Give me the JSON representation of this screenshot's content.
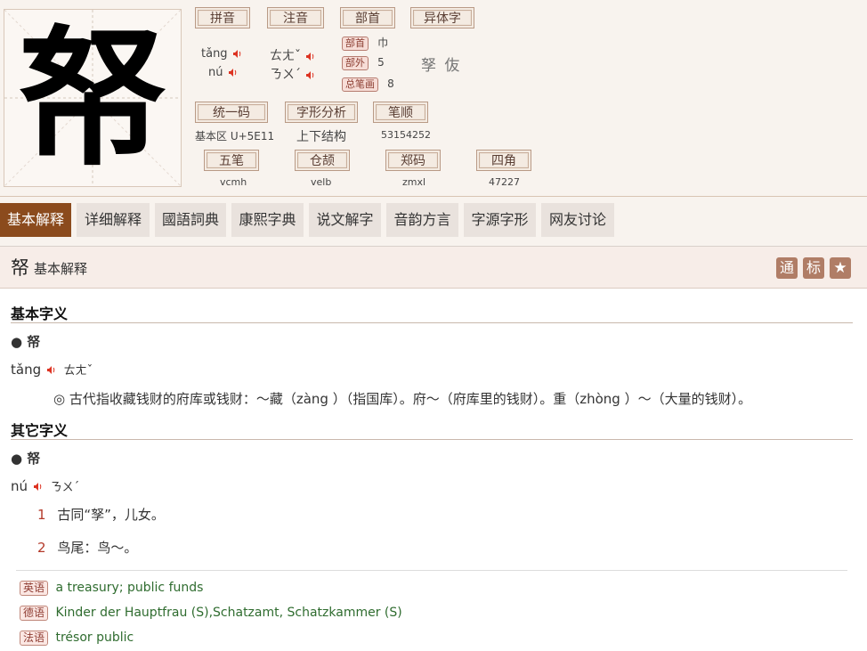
{
  "char": {
    "big": "帑",
    "variants": "孥 伖"
  },
  "frames": {
    "pinyin": "拼音",
    "zhuyin": "注音",
    "bushou": "部首",
    "variant": "异体字",
    "unicode": "统一码",
    "shape": "字形分析",
    "stroke": "笔顺",
    "wubi": "五笔",
    "cangjie": "仓颉",
    "zhengma": "郑码",
    "sijiao": "四角"
  },
  "reading": {
    "pinyin1": "tǎng",
    "pinyin2": "nú",
    "zhuyin1": "ㄊㄤˇ",
    "zhuyin2": "ㄋㄨˊ"
  },
  "radical": {
    "radical_label": "部首",
    "radical_value": "巾",
    "outside_label": "部外",
    "outside_value": "5",
    "total_label": "总笔画",
    "total_value": "8"
  },
  "codes": {
    "unicode_block": "基本区 U+5E11",
    "structure": "上下结构",
    "stroke_order": "53154252",
    "wubi": "vcmh",
    "cangjie": "velb",
    "zhengma": "zmxl",
    "sijiao": "47227"
  },
  "tabs": [
    "基本解释",
    "详细解释",
    "國語詞典",
    "康熙字典",
    "说文解字",
    "音韵方言",
    "字源字形",
    "网友讨论"
  ],
  "section": {
    "char": "帑",
    "title": "基本解释",
    "btn1": "通",
    "btn2": "标",
    "star": "★",
    "basic_title": "基本字义",
    "bullet1": "● 帑",
    "py1": "tǎng",
    "zy1": "ㄊㄤˇ",
    "def1": "◎ 古代指收藏钱财的府库或钱财：～藏（zàng ）（指国库）。府～（府库里的钱财）。重（zhòng ）～（大量的钱财）。",
    "other_title": "其它字义",
    "bullet2": "● 帑",
    "py2": "nú",
    "zy2": "ㄋㄨˊ",
    "n1": "1",
    "def2_1": "古同“孥”，儿女。",
    "n2": "2",
    "def2_2": "鸟尾：鸟～。"
  },
  "translations": {
    "en_tag": "英语",
    "en": "a treasury; public funds",
    "de_tag": "德语",
    "de": "Kinder der Hauptfrau (S),Schatzamt, Schatzkammer (S)",
    "fr_tag": "法语",
    "fr": "trésor public"
  }
}
